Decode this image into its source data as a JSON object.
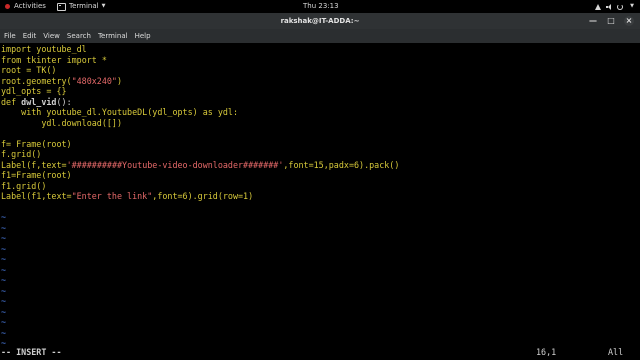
{
  "topbar": {
    "activities": "Activities",
    "app_menu": "Terminal",
    "caret": "▼",
    "clock": "Thu 23:13",
    "tray_caret": "▼"
  },
  "window": {
    "title": "rakshak@IT-ADDA:~",
    "minimize": "—",
    "maximize": "□",
    "close": "×"
  },
  "menubar": {
    "items": [
      "File",
      "Edit",
      "View",
      "Search",
      "Terminal",
      "Help"
    ]
  },
  "editor": {
    "lines": {
      "l1": {
        "kw": "import",
        "rest": " youtube_dl"
      },
      "l2": {
        "kw1": "from",
        "mid": " tkinter ",
        "kw2": "import",
        "rest": " *"
      },
      "l3": {
        "a": "root = TK()"
      },
      "l4": {
        "a": "root.geometry(",
        "str": "\"480x240\"",
        "b": ")"
      },
      "l5": {
        "a": "ydl_opts = {}"
      },
      "l6": {
        "kw": "def",
        "fn": " dwl_vid",
        "rest": "():"
      },
      "l7": {
        "indent": "    ",
        "kw": "with",
        "rest": " youtube_dl.YoutubeDL(ydl_opts) ",
        "kw2": "as",
        "rest2": " ydl:"
      },
      "l8": {
        "indent": "        ",
        "a": "ydl.download([])"
      },
      "l9": {
        "a": ""
      },
      "l10": {
        "a": "f= Frame(root)"
      },
      "l11": {
        "a": "f.grid()"
      },
      "l12": {
        "a": "Label(f,text=",
        "str": "'##########Youtube-video-downloader#######'",
        "b": ",font=15,padx=6).pack()"
      },
      "l13": {
        "a": "f1=Frame(root)"
      },
      "l14": {
        "a": "f1.grid()"
      },
      "l15": {
        "a": "Label(f1,text=",
        "str": "\"Enter the link\"",
        "b": ",font=6).grid(row=1)"
      }
    },
    "tilde": "~"
  },
  "status": {
    "mode": "-- INSERT --",
    "position": "16,1",
    "scroll": "All"
  },
  "colors": {
    "keyword": "#d7c93a",
    "string": "#e56969",
    "text": "#d0d0d0",
    "tilde": "#4a7be0",
    "background": "#000000"
  }
}
